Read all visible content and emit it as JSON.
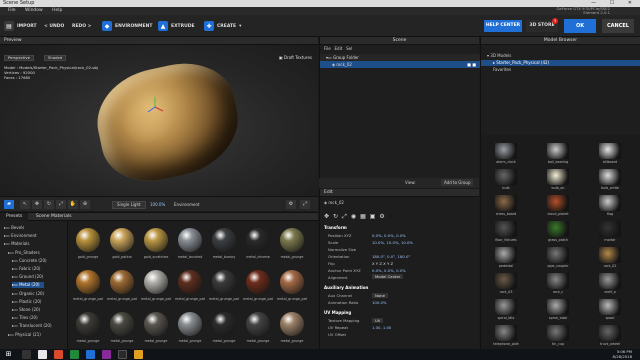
{
  "window": {
    "title": "Scene Setup"
  },
  "menu": [
    "File",
    "Window",
    "Help"
  ],
  "gpu_info": {
    "line1": "GeForce GTX 970/PCIe/SSE2",
    "line2": "Element 2.0.1"
  },
  "toolbar": {
    "import": "IMPORT",
    "undo": "< UNDO",
    "redo": "REDO >",
    "environment": "ENVIRONMENT",
    "extrude": "EXTRUDE",
    "create": "CREATE",
    "help_center": "HELP CENTER",
    "store": "3D STORE",
    "store_badge": "3",
    "ok": "OK",
    "cancel": "CANCEL"
  },
  "preview": {
    "title": "Preview",
    "camera_dd": "Perspective",
    "shading_dd": "Shaded",
    "draft_label": "Draft Textures",
    "info": {
      "model": "Model : Models/Starter_Pack_Physical/rock_02.obj",
      "vertices": "Vertices : 92000",
      "faces": "Faces : 17680"
    },
    "light_mode": "Single Light",
    "light_value": "100.0%",
    "environment_label": "Environment"
  },
  "scene": {
    "title": "Scene",
    "menu": [
      "File",
      "Edit",
      "Sel"
    ],
    "rows": [
      {
        "label": "Group Folder",
        "selected": false
      },
      {
        "label": "rock_02",
        "selected": true
      }
    ],
    "view_label": "View:",
    "add_group": "Add to Group"
  },
  "edit": {
    "title": "Edit",
    "object": "rock_02",
    "sections": {
      "transform": "Transform",
      "aux": "Auxiliary Animation",
      "uv": "UV Mapping"
    },
    "props": [
      {
        "label": "Position XYZ",
        "value": "0.0%, 0.0%, 0.0%"
      },
      {
        "label": "Scale",
        "value": "10.0%, 10.0%, 10.0%"
      },
      {
        "label": "Normalize Size",
        "value": ""
      },
      {
        "label": "Orientation",
        "value": "180.0°, 0.0°, 180.0°"
      },
      {
        "label": "Flip",
        "value": "X Y Z X Y Z"
      },
      {
        "label": "Anchor Point XYZ",
        "value": "0.0%, 0.0%, 0.0%"
      },
      {
        "label": "Alignment",
        "value": "Model Center"
      }
    ],
    "aux_props": [
      {
        "label": "Aux Channel",
        "value": "None"
      },
      {
        "label": "Animation Ratio",
        "value": "100.0%"
      }
    ],
    "uv_props": [
      {
        "label": "Texture Mapping",
        "value": "UV"
      },
      {
        "label": "UV Repeat",
        "value": "1.00, 1.00"
      },
      {
        "label": "UV Offset",
        "value": ""
      }
    ]
  },
  "browser": {
    "title": "Model Browser",
    "tree": [
      {
        "label": "3D Models",
        "indent": 1
      },
      {
        "label": "Starter_Pack_Physical (42)",
        "indent": 2,
        "selected": true
      },
      {
        "label": "Favorites",
        "indent": 2
      }
    ],
    "thumbs": [
      "alarm_clock",
      "ball_bearing",
      "billboard",
      "bulb",
      "bulb_on",
      "bulb_white",
      "chess_board",
      "cloud_planet",
      "flag",
      "floor_fixtures",
      "grass_patch",
      "mortar",
      "pedestal",
      "pipe_coupler",
      "rock_02",
      "rock_03",
      "rock_c",
      "shelf_a",
      "spiral_bits",
      "spiral_tube",
      "spool",
      "telephone_pole",
      "tin_cup",
      "truck_wheel"
    ]
  },
  "materials": {
    "tabs": [
      "Presets",
      "Scene Materials"
    ],
    "tree": [
      {
        "label": "Bevels",
        "indent": 1
      },
      {
        "label": "Environment",
        "indent": 1
      },
      {
        "label": "Materials",
        "indent": 1
      },
      {
        "label": "Pro_Shaders",
        "indent": 2
      },
      {
        "label": "Concrete (20)",
        "indent": 3
      },
      {
        "label": "Fabric (20)",
        "indent": 3
      },
      {
        "label": "Ground (20)",
        "indent": 3
      },
      {
        "label": "Metal (20)",
        "indent": 3,
        "selected": true
      },
      {
        "label": "Organic (20)",
        "indent": 3
      },
      {
        "label": "Plastic (20)",
        "indent": 3
      },
      {
        "label": "Stone (20)",
        "indent": 3
      },
      {
        "label": "Tiles (20)",
        "indent": 3
      },
      {
        "label": "Translucent (20)",
        "indent": 3
      },
      {
        "label": "Physical (21)",
        "indent": 2
      }
    ],
    "spheres": [
      {
        "name": "gold_grunge",
        "color": "#b8913c"
      },
      {
        "name": "gold_patina",
        "color": "#caa45a"
      },
      {
        "name": "gold_scratches",
        "color": "#bb9744"
      },
      {
        "name": "metal_brushed",
        "color": "#8a8f96"
      },
      {
        "name": "metal_bumpy",
        "color": "#3b3e42"
      },
      {
        "name": "metal_chrome",
        "color": "#2a2a2a"
      },
      {
        "name": "metal_grunge",
        "color": "#7d7a4e"
      },
      {
        "name": "metal_grunge_pat",
        "color": "#b0742c"
      },
      {
        "name": "metal_grunge_pat",
        "color": "#9c6a34"
      },
      {
        "name": "metal_grunge_pat",
        "color": "#b3b1ac"
      },
      {
        "name": "metal_grunge_pat",
        "color": "#5e2f1f"
      },
      {
        "name": "metal_grunge_pat",
        "color": "#3a3a3a"
      },
      {
        "name": "metal_grunge_pat",
        "color": "#6e2d1c"
      },
      {
        "name": "metal_grunge_pat",
        "color": "#a46a46"
      },
      {
        "name": "metal_grunge",
        "color": "#3e3b36"
      },
      {
        "name": "metal_grunge",
        "color": "#4a4a42"
      },
      {
        "name": "metal_grunge",
        "color": "#5a5650"
      },
      {
        "name": "metal_grunge",
        "color": "#8a8e92"
      },
      {
        "name": "metal_grunge",
        "color": "#2c2c2c"
      },
      {
        "name": "metal_grunge",
        "color": "#444"
      },
      {
        "name": "metal_grunge",
        "color": "#9d8168"
      }
    ]
  },
  "taskbar": {
    "time": "5:06 PM",
    "date": "8/28/2018"
  }
}
